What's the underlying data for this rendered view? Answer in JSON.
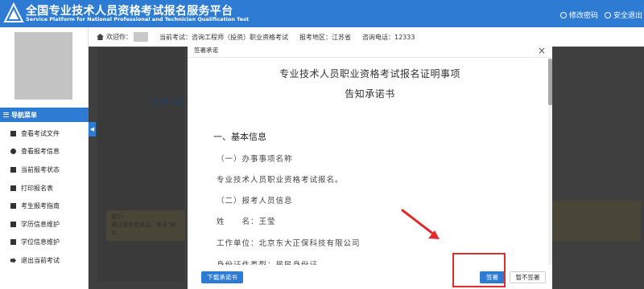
{
  "header": {
    "title": "全国专业技术人员资格考试报名服务平台",
    "subtitle": "Service Platform for National Professional and Technician Qualification Test",
    "links": [
      "修改密码",
      "安全退出"
    ]
  },
  "infobar": {
    "welcome": "欢迎你：",
    "exam": "当前考试：咨询工程师（投资）职业资格考试",
    "region": "报考地区：江苏省",
    "phone": "咨询电话：12333"
  },
  "sidebar": {
    "nav_title": "导航菜单",
    "items": [
      {
        "label": "查看考试文件"
      },
      {
        "label": "查看报考信息"
      },
      {
        "label": "当前报考状态"
      },
      {
        "label": "打印报名表"
      },
      {
        "label": "考生报考指南"
      },
      {
        "label": "学历信息维护"
      },
      {
        "label": "学位信息维护"
      },
      {
        "label": "退出当前考试"
      }
    ]
  },
  "background": {
    "uploaded": "已上传（点",
    "tip_title": "提示:",
    "tip_text": "确认报名信息后，单击\"报名"
  },
  "modal": {
    "title": "签署承诺",
    "close": "×",
    "doc_title_1": "专业技术人员职业资格考试报名证明事项",
    "doc_title_2": "告知承诺书",
    "section_1": "一、基本信息",
    "sub_1": "（一）办事事项名称",
    "item_name": "专业技术人员职业资格考试报名。",
    "sub_2": "（二）报考人员信息",
    "name_line": "姓　　名：王莹",
    "company_line": "工作单位：北京东大正保科技有限公司",
    "id_line": "身份证件类型：居民身份证",
    "btn_download": "下载承诺书",
    "btn_sign": "签署",
    "btn_nosign": "暂不签署"
  },
  "colors": {
    "brand_blue": "#2e7bd4",
    "overlay": "#3f3f3f",
    "annotation_red": "#e02c2c"
  }
}
